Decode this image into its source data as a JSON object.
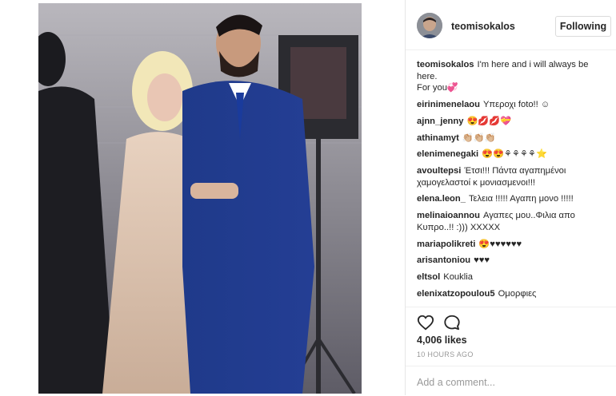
{
  "post": {
    "photo_alt": "photo",
    "author": "teomisokalos",
    "follow_label": "Following",
    "caption": {
      "user": "teomisokalos",
      "text": "I'm here and i will always be here.\nFor you💞"
    },
    "comments": [
      {
        "user": "eirinimenelaou",
        "text": "Υπεροχι foto!! ☺"
      },
      {
        "user": "ajnn_jenny",
        "text": "😍💋💋💝"
      },
      {
        "user": "athinamyt",
        "text": "👏🏼👏🏼👏🏼"
      },
      {
        "user": "elenimenegaki",
        "text": "😍😍⚘⚘⚘⚘⭐"
      },
      {
        "user": "avoultepsi",
        "text": "Έτσι!!! Πάντα αγαπημένοι χαμογελαστοί κ μονιασμενοι!!!"
      },
      {
        "user": "elena.leon_",
        "text": "Τελεια !!!!! Αγαπη μονο !!!!!"
      },
      {
        "user": "melinaioannou",
        "text": "Αγαπες μου..Φιλια απο Κυπρο..!! :))) XXXXX"
      },
      {
        "user": "mariapolikreti",
        "text": "😍♥♥♥♥♥♥"
      },
      {
        "user": "arisantoniou",
        "text": "♥♥♥"
      },
      {
        "user": "eltsol",
        "text": "Kouklia"
      },
      {
        "user": "elenixatzopoulou5",
        "text": "Ομορφιες"
      },
      {
        "user": "...",
        "text": ""
      }
    ],
    "likes": "4,006 likes",
    "time_ago": "10 HOURS AGO",
    "add_comment_placeholder": "Add a comment...",
    "icons": {
      "like": "heart-icon",
      "comment": "comment-icon"
    },
    "colors": {
      "text": "#262626",
      "muted": "#999999",
      "border": "#efefef"
    }
  }
}
